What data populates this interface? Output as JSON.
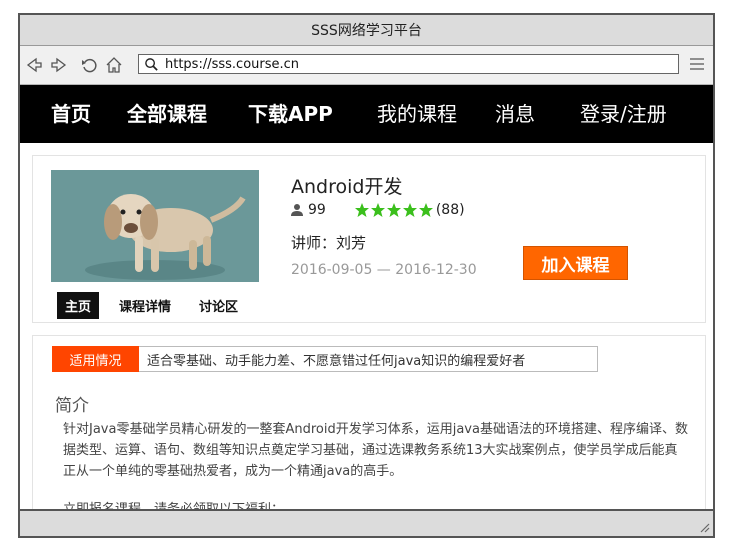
{
  "window": {
    "title": "SSS网络学习平台"
  },
  "browser": {
    "url": "https://sss.course.cn",
    "icons": [
      "back-icon",
      "forward-icon",
      "reload-icon",
      "home-icon",
      "search-icon",
      "menu-icon"
    ]
  },
  "nav": {
    "items": [
      {
        "label": "首页",
        "bold": true
      },
      {
        "label": "全部课程",
        "bold": true
      },
      {
        "label": "下载APP",
        "bold": true
      },
      {
        "label": "我的课程",
        "bold": false
      },
      {
        "label": "消息",
        "bold": false
      },
      {
        "label": "登录/注册",
        "bold": false
      }
    ]
  },
  "course": {
    "title": "Android开发",
    "students": "99",
    "rating_stars": 5,
    "rating_count": "(88)",
    "teacher": "讲师：刘芳",
    "dates": "2016-09-05 — 2016-12-30",
    "join_label": "加入课程",
    "star_color": "#3bbf1c",
    "accent_color": "#ff6600"
  },
  "tabs": [
    {
      "label": "主页",
      "active": true
    },
    {
      "label": "课程详情",
      "active": false
    },
    {
      "label": "讨论区",
      "active": false
    }
  ],
  "suitability": {
    "tag": "适用情况",
    "text": "适合零基础、动手能力差、不愿意错过任何java知识的编程爱好者"
  },
  "intro": {
    "heading": "简介",
    "paragraph": "针对Java零基础学员精心研发的一整套Android开发学习体系，运用java基础语法的环境搭建、程序编译、数据类型、运算、语句、数组等知识点奠定学习基础，通过选课教务系统13大实战案例点，使学员学成后能真正从一个单纯的零基础热爱者，成为一个精通java的高手。",
    "partial_line": "立即报名课程，请务必领取以下福利："
  }
}
